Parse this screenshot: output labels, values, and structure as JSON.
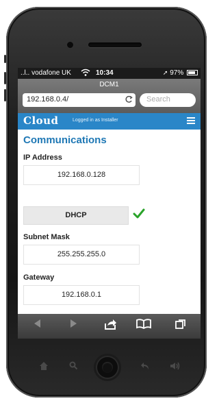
{
  "status": {
    "carrier": "..l.. vodafone UK",
    "wifi_icon": "wifi-icon",
    "time": "10:34",
    "battery": "97%"
  },
  "browser": {
    "page_title": "DCM1",
    "url": "192.168.0.4/",
    "refresh_icon": "refresh-icon",
    "search_placeholder": "Search"
  },
  "header": {
    "logo": "Cloud",
    "logged_in": "Logged in as Installer",
    "menu_icon": "hamburger-menu-icon"
  },
  "main": {
    "title": "Communications",
    "ip_label": "IP Address",
    "ip_value": "192.168.0.128",
    "dhcp_label": "DHCP",
    "subnet_label": "Subnet Mask",
    "subnet_value": "255.255.255.0",
    "gateway_label": "Gateway",
    "gateway_value": "192.168.0.1"
  },
  "toolbar": {
    "back_icon": "back-icon",
    "forward_icon": "forward-icon",
    "share_icon": "share-icon",
    "bookmarks_icon": "bookmarks-icon",
    "tabs_icon": "tabs-icon"
  },
  "phone": {
    "home_icon": "home-icon",
    "search_icon": "search-icon",
    "back_icon": "back-arrow-icon",
    "volume_icon": "volume-icon"
  },
  "colors": {
    "brand": "#2a86c8",
    "title": "#1f78b5",
    "check": "#2aa32a"
  }
}
